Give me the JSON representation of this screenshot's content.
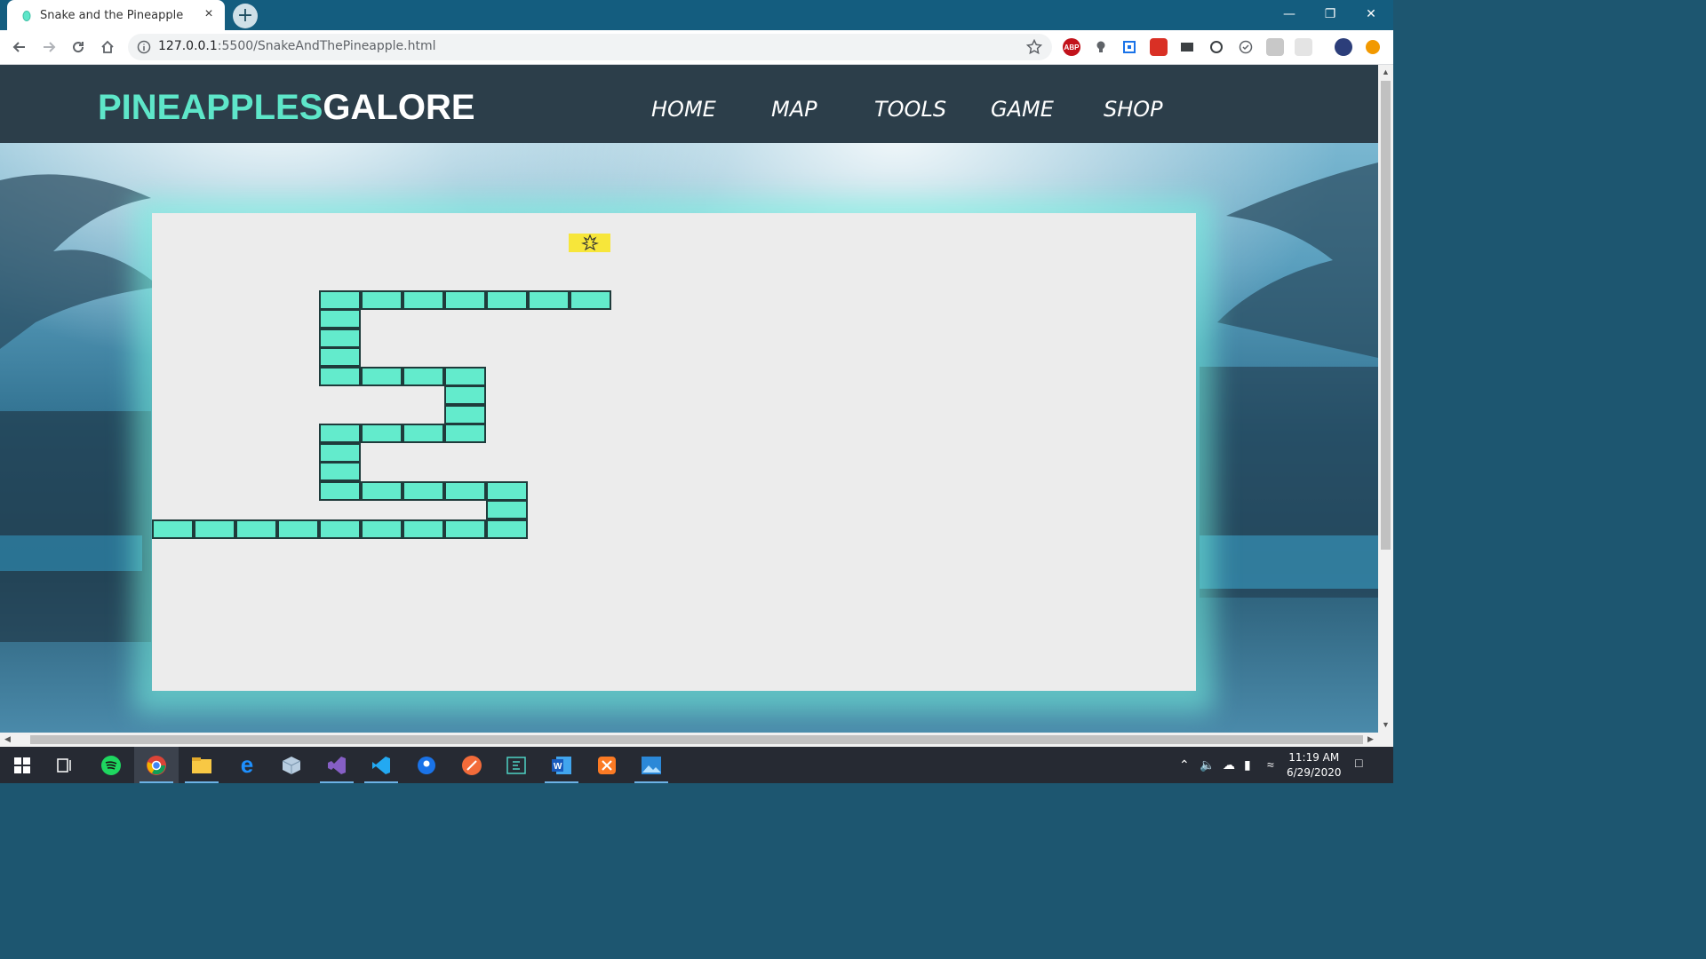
{
  "browser": {
    "tab_title": "Snake and the Pineapple",
    "tab_close": "×",
    "new_tab": "+",
    "url_host": "127.0.0.1",
    "url_path": ":5500/SnakeAndThePineapple.html"
  },
  "site": {
    "logo_part1": "PINEAPPLES",
    "logo_part2": "GALORE",
    "nav": [
      "HOME",
      "MAP",
      "TOOLS",
      "GAME",
      "SHOP"
    ],
    "colors": {
      "header_bg": "#2c3e4a",
      "accent": "#5ee6c9",
      "snake": "#63ebcc",
      "pineapple_tile": "#f7e63a",
      "board": "#ececec"
    }
  },
  "game": {
    "grid_columns": 25,
    "grid_rows": 25,
    "pineapple": {
      "col": 10,
      "row": 1
    },
    "snake": [
      [
        0,
        16
      ],
      [
        1,
        16
      ],
      [
        2,
        16
      ],
      [
        3,
        16
      ],
      [
        4,
        16
      ],
      [
        5,
        16
      ],
      [
        6,
        16
      ],
      [
        7,
        16
      ],
      [
        8,
        16
      ],
      [
        8,
        15
      ],
      [
        8,
        14
      ],
      [
        7,
        14
      ],
      [
        6,
        14
      ],
      [
        5,
        14
      ],
      [
        4,
        14
      ],
      [
        4,
        13
      ],
      [
        4,
        12
      ],
      [
        4,
        11
      ],
      [
        5,
        11
      ],
      [
        6,
        11
      ],
      [
        7,
        11
      ],
      [
        7,
        10
      ],
      [
        7,
        9
      ],
      [
        7,
        8
      ],
      [
        6,
        8
      ],
      [
        5,
        8
      ],
      [
        4,
        8
      ],
      [
        4,
        7
      ],
      [
        4,
        6
      ],
      [
        4,
        5
      ],
      [
        4,
        4
      ],
      [
        5,
        4
      ],
      [
        6,
        4
      ],
      [
        7,
        4
      ],
      [
        8,
        4
      ],
      [
        9,
        4
      ],
      [
        10,
        4
      ]
    ]
  },
  "taskbar": {
    "time": "11:19 AM",
    "date": "6/29/2020",
    "apps": [
      "spotify-icon",
      "chrome-icon",
      "file-explorer-icon",
      "edge-icon",
      "box-icon",
      "visual-studio-icon",
      "vscode-icon",
      "maps-icon",
      "sketch-icon",
      "terminal-icon",
      "word-icon",
      "xampp-icon",
      "photos-icon"
    ]
  }
}
